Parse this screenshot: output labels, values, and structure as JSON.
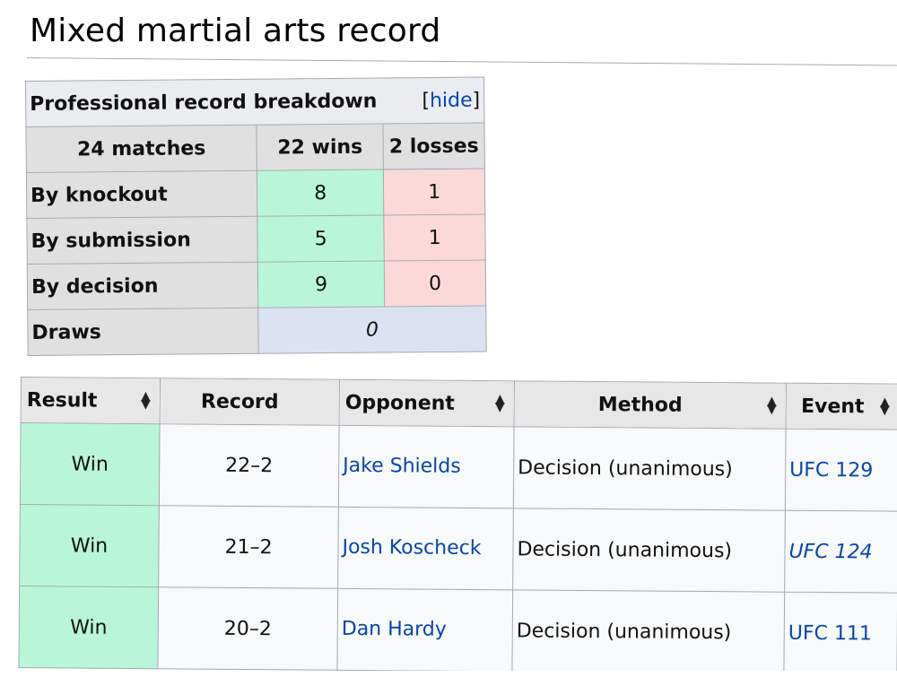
{
  "heading": "Mixed martial arts record",
  "breakdown": {
    "title": "Professional record breakdown",
    "hide_open": "[",
    "hide_label": "hide",
    "hide_close": "]",
    "matches": "24 matches",
    "wins": "22 wins",
    "losses": "2 losses",
    "rows": [
      {
        "label": "By knockout",
        "wins": "8",
        "losses": "1"
      },
      {
        "label": "By submission",
        "wins": "5",
        "losses": "1"
      },
      {
        "label": "By decision",
        "wins": "9",
        "losses": "0"
      }
    ],
    "draws_label": "Draws",
    "draws_value": "0"
  },
  "record": {
    "headers": [
      "Result",
      "Record",
      "Opponent",
      "Method",
      "Event"
    ],
    "rows": [
      {
        "result": "Win",
        "record": "22–2",
        "opponent": "Jake Shields",
        "method": "Decision (unanimous)",
        "event": "UFC 129"
      },
      {
        "result": "Win",
        "record": "21–2",
        "opponent": "Josh Koscheck",
        "method": "Decision (unanimous)",
        "event": "UFC 124"
      },
      {
        "result": "Win",
        "record": "20–2",
        "opponent": "Dan Hardy",
        "method": "Decision (unanimous)",
        "event": "UFC 111"
      }
    ]
  },
  "icons": {
    "sort": "sort-arrows-icon"
  },
  "colors": {
    "win": "#b9f6d9",
    "loss": "#fcd9d9",
    "draw": "#dbe3f3",
    "link": "#0645ad"
  }
}
